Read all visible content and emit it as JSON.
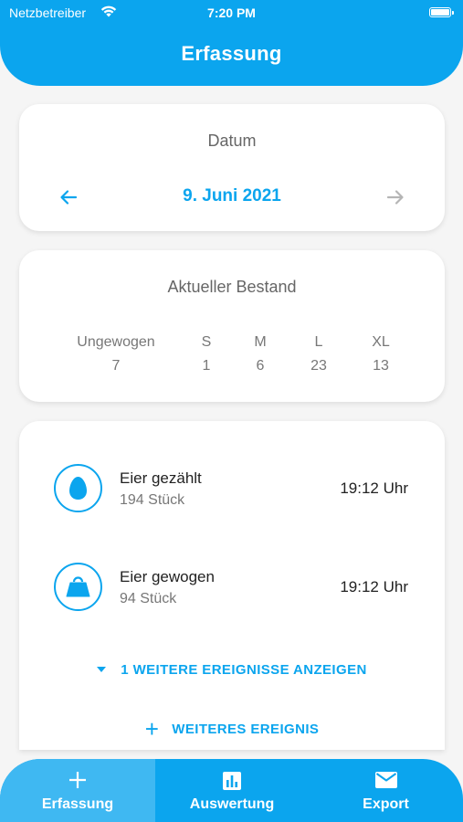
{
  "status_bar": {
    "carrier": "Netzbetreiber",
    "time": "7:20 PM"
  },
  "header": {
    "title": "Erfassung"
  },
  "date_card": {
    "title": "Datum",
    "date": "9. Juni 2021",
    "prev_icon": "arrow-left-icon",
    "next_icon": "arrow-right-icon"
  },
  "stock_card": {
    "title": "Aktueller Bestand",
    "columns": [
      {
        "label": "Ungewogen",
        "value": "7"
      },
      {
        "label": "S",
        "value": "1"
      },
      {
        "label": "M",
        "value": "6"
      },
      {
        "label": "L",
        "value": "23"
      },
      {
        "label": "XL",
        "value": "13"
      }
    ]
  },
  "events": [
    {
      "icon": "egg-icon",
      "name": "Eier gezählt",
      "count": "194 Stück",
      "time": "19:12 Uhr"
    },
    {
      "icon": "scale-icon",
      "name": "Eier gewogen",
      "count": "94 Stück",
      "time": "19:12 Uhr"
    }
  ],
  "more_events_label": "1 WEITERE EREIGNISSE ANZEIGEN",
  "add_event_label": "WEITERES EREIGNIS",
  "bottom_nav": [
    {
      "label": "Erfassung",
      "icon": "plus-icon",
      "active": true
    },
    {
      "label": "Auswertung",
      "icon": "bar-chart-icon",
      "active": false
    },
    {
      "label": "Export",
      "icon": "mail-icon",
      "active": false
    }
  ],
  "colors": {
    "accent": "#0ba5ee",
    "nav_active": "#3fb8f2",
    "background": "#f5f5f5"
  }
}
